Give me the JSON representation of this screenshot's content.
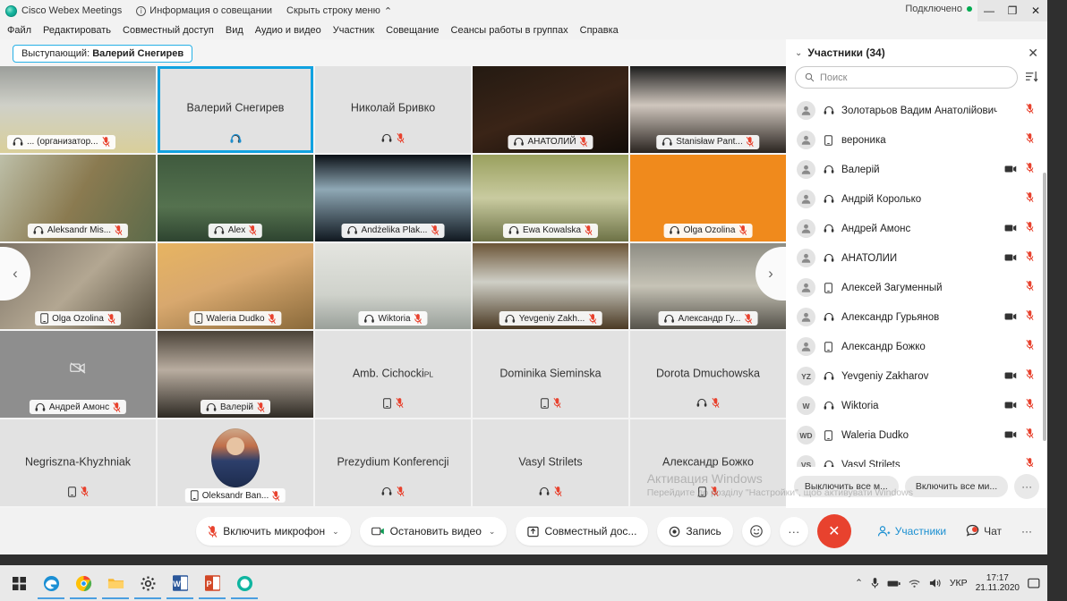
{
  "window": {
    "app_title": "Cisco Webex Meetings",
    "meeting_info": "Информация о совещании",
    "hide_menubar": "Скрыть строку меню",
    "connected": "Подключено",
    "minimize": "—",
    "maximize": "❐",
    "close": "✕"
  },
  "menubar": [
    "Файл",
    "Редактировать",
    "Совместный доступ",
    "Вид",
    "Аудио и видео",
    "Участник",
    "Совещание",
    "Сеансы работы в группах",
    "Справка"
  ],
  "stage": {
    "speaker_label": "Выступающий:",
    "speaker_name": "Валерий Снегирев",
    "prev_arrow": "‹",
    "next_arrow": "›"
  },
  "tiles": [
    {
      "name": "... (организатор...",
      "mode": "video",
      "chip": "left",
      "device": "headset",
      "muted": true,
      "bg": "linear-gradient(180deg,#9b9e9a 0%,#cfd0c8 45%,#d9cf9a 100%)"
    },
    {
      "name": "Валерий Снегирев",
      "mode": "name",
      "device": "headset-active",
      "muted": false,
      "active": true,
      "bg": "#e2e2e2"
    },
    {
      "name": "Николай Бривко",
      "mode": "name",
      "device": "headset",
      "muted": true,
      "bg": "#e2e2e2"
    },
    {
      "name": "АНАТОЛИЙ",
      "mode": "video",
      "device": "headset",
      "muted": true,
      "bg": "linear-gradient(160deg,#241a12 0%,#3a2417 50%,#120c08 100%)"
    },
    {
      "name": "Stanisław Pant...",
      "mode": "video",
      "device": "headset",
      "muted": true,
      "bg": "linear-gradient(180deg,#1c1c1c 0%,#cfc6bd 45%,#2a2420 100%)"
    },
    {
      "name": "Aleksandr Mis...",
      "mode": "video",
      "device": "headset",
      "muted": true,
      "bg": "linear-gradient(120deg,#bdbfa8 0%,#8a7a50 50%,#5c6b4a 100%)"
    },
    {
      "name": "Alex",
      "mode": "video",
      "device": "headset",
      "muted": true,
      "bg": "linear-gradient(180deg,#3f5a3e 0%,#55724f 60%,#2e4430 100%)"
    },
    {
      "name": "Andżelika Plak...",
      "mode": "video",
      "device": "headset",
      "muted": true,
      "bg": "linear-gradient(180deg,#0b1016 0%,#8fa8b5 40%,#101820 100%)"
    },
    {
      "name": "Ewa Kowalska",
      "mode": "video",
      "device": "headset",
      "muted": true,
      "bg": "linear-gradient(180deg,#9aa05e 0%,#c9cba0 50%,#6d7246 100%)"
    },
    {
      "name": "Olga Ozolina",
      "mode": "video",
      "device": "headset",
      "muted": true,
      "bg": "#f08a1c"
    },
    {
      "name": "Olga Ozolina",
      "mode": "video",
      "device": "phone",
      "muted": true,
      "bg": "linear-gradient(135deg,#7d7366 0%,#b3a792 50%,#58503f 100%)"
    },
    {
      "name": "Waleria Dudko",
      "mode": "video",
      "device": "phone",
      "muted": true,
      "bg": "linear-gradient(160deg,#e7b461 0%,#d8a86e 45%,#8a6a3b 100%)"
    },
    {
      "name": "Wiktoria",
      "mode": "video",
      "device": "headset",
      "muted": true,
      "bg": "linear-gradient(180deg,#e4e5e0 0%,#cfd2cb 60%,#9aa09a 100%)"
    },
    {
      "name": "Yevgeniy Zakh...",
      "mode": "video",
      "device": "headset",
      "muted": true,
      "bg": "linear-gradient(180deg,#6b5436 0%,#cfcfc6 45%,#4b3a24 100%)"
    },
    {
      "name": "Александр Гу...",
      "mode": "video",
      "device": "headset",
      "muted": true,
      "bg": "linear-gradient(180deg,#8d8c83 0%,#c6c3b6 50%,#55524a 100%)"
    },
    {
      "name": "Андрей Амонс",
      "mode": "video",
      "device": "headset",
      "muted": true,
      "bg": "#8e8e8e",
      "camera_off_glyph": true
    },
    {
      "name": "Валерій",
      "mode": "video",
      "device": "headset",
      "muted": true,
      "bg": "linear-gradient(180deg,#4a4238 0%,#b9ada0 45%,#2e2a24 100%)"
    },
    {
      "name": "Amb. Cichocki",
      "name_suffix": "PL",
      "mode": "name",
      "device": "phone",
      "muted": true,
      "bg": "#e2e2e2"
    },
    {
      "name": "Dominika Sieminska",
      "mode": "name",
      "device": "phone",
      "muted": true,
      "bg": "#e2e2e2"
    },
    {
      "name": "Dorota Dmuchowska",
      "mode": "name",
      "device": "headset",
      "muted": true,
      "bg": "#e2e2e2"
    },
    {
      "name": "Negriszna-Khyzhniak",
      "mode": "name",
      "device": "phone",
      "muted": true,
      "bg": "#e2e2e2"
    },
    {
      "name": "Oleksandr Ban...",
      "mode": "avatar",
      "device": "phone",
      "muted": true,
      "bg": "#e2e2e2"
    },
    {
      "name": "Prezydium Konferencji",
      "mode": "name",
      "device": "headset",
      "muted": true,
      "bg": "#e2e2e2"
    },
    {
      "name": "Vasyl Strilets",
      "mode": "name",
      "device": "headset",
      "muted": true,
      "bg": "#e2e2e2"
    },
    {
      "name": "Александр Божко",
      "mode": "name",
      "device": "phone",
      "muted": true,
      "bg": "#e2e2e2"
    }
  ],
  "panel": {
    "title": "Участники (34)",
    "collapse_icon": "⌄",
    "close_icon": "✕",
    "search_placeholder": "Поиск",
    "search_value": "",
    "sort_icon": "sort-icon",
    "participants": [
      {
        "initials": "VS",
        "name": "Vasyl Strilets",
        "device": "headset",
        "camera": false,
        "muted": true
      },
      {
        "initials": "WD",
        "name": "Waleria Dudko",
        "device": "phone",
        "camera": true,
        "muted": true
      },
      {
        "initials": "W",
        "name": "Wiktoria",
        "device": "headset",
        "camera": true,
        "muted": true
      },
      {
        "initials": "YZ",
        "name": "Yevgeniy Zakharov",
        "device": "headset",
        "camera": true,
        "muted": true
      },
      {
        "initials": "",
        "name": "Александр Божко",
        "device": "phone",
        "camera": false,
        "muted": true
      },
      {
        "initials": "",
        "name": "Александр Гурьянов",
        "device": "headset",
        "camera": true,
        "muted": true
      },
      {
        "initials": "",
        "name": "Алексей Загуменный",
        "device": "phone",
        "camera": false,
        "muted": true
      },
      {
        "initials": "",
        "name": "АНАТОЛИЙ",
        "device": "headset",
        "camera": true,
        "muted": true
      },
      {
        "initials": "",
        "name": "Андрей Амонс",
        "device": "headset",
        "camera": true,
        "muted": true
      },
      {
        "initials": "",
        "name": "Андрій Королько",
        "device": "headset",
        "camera": false,
        "muted": true
      },
      {
        "initials": "",
        "name": "Валерій",
        "device": "headset",
        "camera": true,
        "muted": true
      },
      {
        "initials": "",
        "name": "вероника",
        "device": "phone",
        "camera": false,
        "muted": true
      },
      {
        "initials": "",
        "name": "Золотарьов Вадим Анатолійович",
        "device": "headset",
        "camera": false,
        "muted": true
      }
    ],
    "mute_all": "Выключить все м...",
    "unmute_all": "Включить все ми...",
    "more": "···"
  },
  "toolbar": {
    "mic": "Включить микрофон",
    "video": "Остановить видео",
    "share": "Совместный дос...",
    "record": "Запись",
    "reactions_icon": "smiley-icon",
    "more_icon": "···",
    "end_call_icon": "✕",
    "participants": "Участники",
    "chat": "Чат",
    "right_more": "···",
    "caret": "⌄"
  },
  "watermark": {
    "line1": "Активация Windows",
    "line2": "Перейдите до розділу \"Настройки\", щоб активувати Windows"
  },
  "taskbar": {
    "items": [
      "start-icon",
      "edge-icon",
      "chrome-icon",
      "explorer-icon",
      "settings-icon",
      "word-icon",
      "powerpoint-icon",
      "webex-icon"
    ],
    "tray": {
      "chevron": "⌃",
      "language": "УКР",
      "time": "17:17",
      "date": "21.11.2020"
    }
  }
}
